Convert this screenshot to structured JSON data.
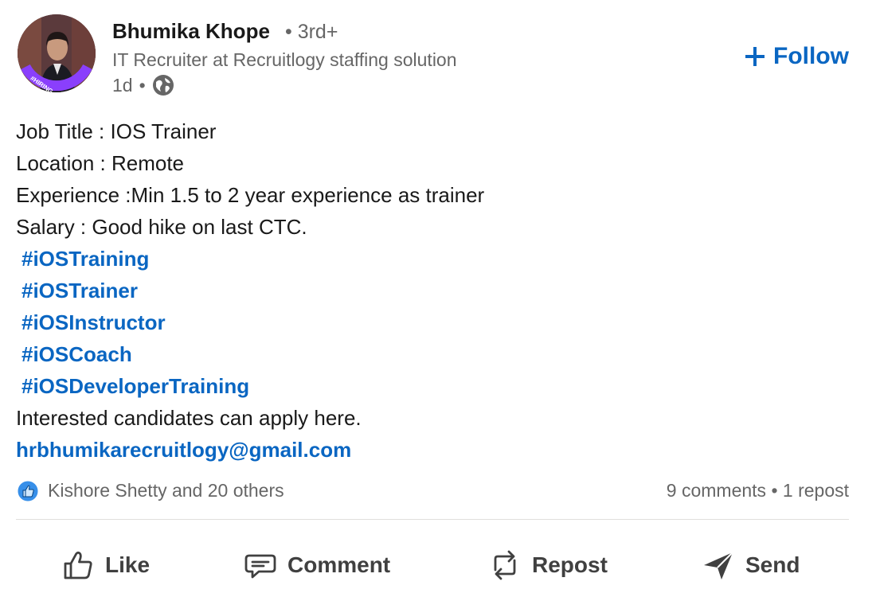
{
  "author": {
    "name": "Bhumika Khope",
    "degree": "• 3rd+",
    "headline": "IT Recruiter at Recruitlogy staffing solution",
    "time": "1d",
    "meta_separator": "•",
    "avatar_badge": "#HIRING"
  },
  "follow": {
    "label": "Follow",
    "icon": "plus-icon"
  },
  "post": {
    "job_title": "Job Title : IOS Trainer",
    "location": "Location : Remote",
    "experience": "Experience :Min 1.5 to 2 year experience as trainer",
    "salary": "Salary : Good hike on last CTC.",
    "hashtags": [
      "#iOSTraining",
      "#iOSTrainer",
      "#iOSInstructor",
      "#iOSCoach",
      "#iOSDeveloperTraining"
    ],
    "cta": "Interested candidates can apply here.",
    "email": "hrbhumikarecruitlogy@gmail.com"
  },
  "social": {
    "reactors": "Kishore Shetty and 20 others",
    "comments": "9 comments",
    "separator": "•",
    "reposts": "1 repost"
  },
  "actions": {
    "like": "Like",
    "comment": "Comment",
    "repost": "Repost",
    "send": "Send"
  },
  "colors": {
    "link": "#0a66c2",
    "text": "#191919",
    "muted": "#666666",
    "avatar_ring": "#8a3ffc"
  }
}
